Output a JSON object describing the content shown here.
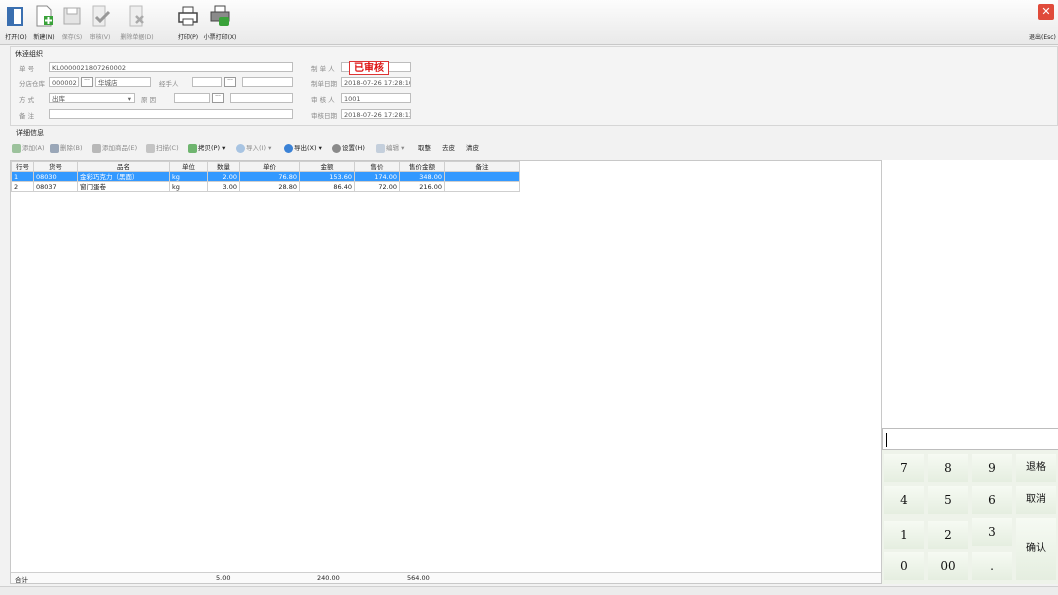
{
  "toolbar": {
    "open": "打开(O)",
    "new": "新建(N)",
    "save": "保存(S)",
    "audit": "审核(V)",
    "delete_doc": "删除单据(D)",
    "print": "打印(P)",
    "ticket_print": "小票打印(X)",
    "exit": "退出(Esc)"
  },
  "header": {
    "section_title": "休逹组织",
    "order_no_label": "单 号",
    "order_no_value": "KL000002180726000​2",
    "branch_label": "分店仓库",
    "branch_code": "000002",
    "branch_name": "华城店",
    "handler_label": "经手人",
    "method_label": "方 式",
    "method_value": "出库",
    "reason_label": "原 因",
    "remark_label": "备 注",
    "creator_label": "制 单 人",
    "audit_stamp": "已审核",
    "create_date_label": "制单日期",
    "create_date_value": "2018-07-26 17:28:10",
    "auditor_label": "审 核 人",
    "auditor_value": "1001",
    "audit_date_label": "审核日期",
    "audit_date_value": "2018-07-26 17:28:13"
  },
  "detail": {
    "title": "详细信息",
    "toolbar": {
      "add": "添加(A)",
      "delete": "删除(B)",
      "add_goods": "添加商品(E)",
      "scan": "扫描(C)",
      "copy": "拷贝(P)",
      "import": "导入(I)",
      "export": "导出(X)",
      "settings": "设置(H)",
      "edit": "编辑",
      "round": "取整",
      "drop_decimal": "去皮",
      "clear_skin": "清皮"
    },
    "columns": [
      "行号",
      "货号",
      "品名",
      "单位",
      "数量",
      "单价",
      "金额",
      "售价",
      "售价金额",
      "备注"
    ],
    "rows": [
      [
        "1",
        "08030",
        "金彩巧克力（黑面）",
        "kg",
        "2.00",
        "76.80",
        "153.60",
        "174.00",
        "348.00",
        ""
      ],
      [
        "2",
        "08037",
        "窗门蛋卷",
        "kg",
        "3.00",
        "28.80",
        "86.40",
        "72.00",
        "216.00",
        ""
      ]
    ],
    "totals": {
      "label": "合计",
      "qty": "5.00",
      "amount": "240.00",
      "sale_amount": "564.00"
    }
  },
  "keypad": {
    "k7": "7",
    "k8": "8",
    "k9": "9",
    "back": "退格",
    "k4": "4",
    "k5": "5",
    "k6": "6",
    "cancel": "取消",
    "k1": "1",
    "k2": "2",
    "k3": "3",
    "confirm": "确认",
    "k0": "0",
    "k00": "00",
    "dot": "."
  },
  "colors": {
    "selection": "#3399ff",
    "stamp": "#dd1111",
    "keypad": "#eef3ea",
    "exit": "#e04a3a"
  }
}
